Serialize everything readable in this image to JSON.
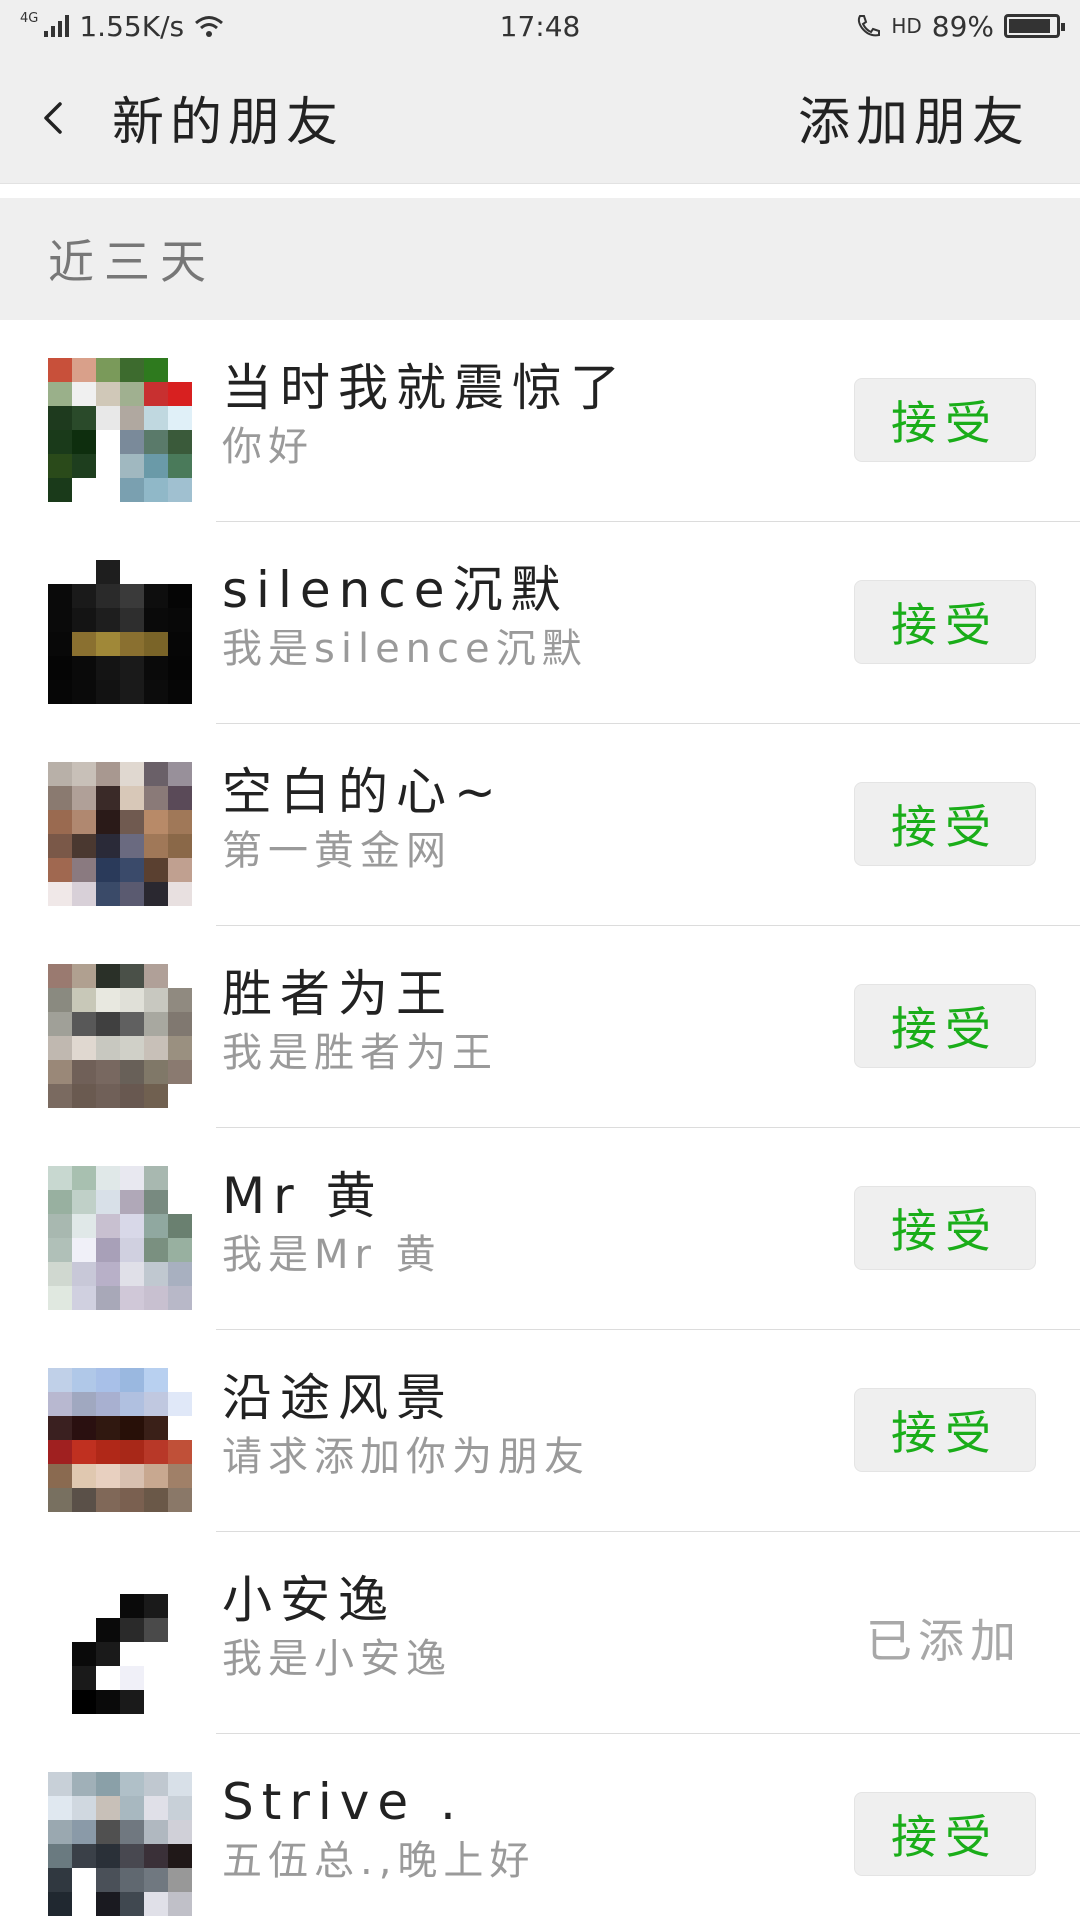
{
  "status_bar": {
    "network": "4G",
    "speed": "1.55K/s",
    "time": "17:48",
    "hd": "HD",
    "battery": "89%",
    "battery_level": 0.89
  },
  "nav": {
    "title": "新的朋友",
    "action": "添加朋友"
  },
  "section": {
    "title": "近三天"
  },
  "accent_color": "#1aad19",
  "friends": [
    {
      "name": "当时我就震惊了",
      "message": "你好",
      "action": "接受",
      "status": "pending",
      "avatar": [
        "#c8503a",
        "#d9a08a",
        "#7a9a5a",
        "#3d6b2e",
        "#2e7a1e",
        "#ffffff",
        "#9ab08a",
        "#f0f0f0",
        "#d0c8b8",
        "#a0b090",
        "#c83030",
        "#d82020",
        "#1e3a1e",
        "#2a4a2a",
        "#e8e8e8",
        "#b0a8a0",
        "#c0d8e0",
        "#e0f0f8",
        "#1a3a1a",
        "#0e2e0e",
        "#ffffff",
        "#7a8a9a",
        "#5a7a6a",
        "#3a5a3a",
        "#2a4a1a",
        "#1e3e1e",
        "#ffffff",
        "#a0b8c0",
        "#6a9aa8",
        "#4a7a5a",
        "#1a3a1a",
        "#ffffff",
        "#ffffff",
        "#7aa0b0",
        "#90b8c8",
        "#a0c0d0"
      ]
    },
    {
      "name": "silence沉默",
      "message": "我是silence沉默",
      "action": "接受",
      "status": "pending",
      "avatar": [
        "#ffffff",
        "#ffffff",
        "#1e1e1e",
        "#ffffff",
        "#ffffff",
        "#ffffff",
        "#0a0a0a",
        "#1a1a1a",
        "#2a2a2a",
        "#3a3a3a",
        "#0e0e0e",
        "#050505",
        "#0a0a0a",
        "#141414",
        "#1e1e1e",
        "#2e2e2e",
        "#0a0a0a",
        "#080808",
        "#080808",
        "#8a7030",
        "#a08838",
        "#8a7030",
        "#7a6428",
        "#060606",
        "#050505",
        "#0a0a0a",
        "#141414",
        "#1a1a1a",
        "#0a0a0a",
        "#050505",
        "#060606",
        "#0a0a0a",
        "#121212",
        "#1a1a1a",
        "#0c0c0c",
        "#060606"
      ]
    },
    {
      "name": "空白的心~",
      "message": "第一黄金网",
      "action": "接受",
      "status": "pending",
      "avatar": [
        "#b8b0a8",
        "#c8c0b8",
        "#a89890",
        "#e0d8d0",
        "#6a6068",
        "#98909a",
        "#8a7a70",
        "#b0a098",
        "#3a2a28",
        "#d8c8b8",
        "#8a7a78",
        "#5a4a58",
        "#9a6a50",
        "#b08870",
        "#2a1a18",
        "#705a50",
        "#b88a68",
        "#a07858",
        "#7a5848",
        "#4a3830",
        "#2a2a38",
        "#6a6a80",
        "#a07858",
        "#8a6848",
        "#a06850",
        "#8a7a80",
        "#2a3a5a",
        "#3a4a6a",
        "#5a4030",
        "#c0a090",
        "#f0e8e8",
        "#d8d0d8",
        "#3a4a68",
        "#5a5a70",
        "#2a2830",
        "#e8e0e0"
      ]
    },
    {
      "name": "胜者为王",
      "message": "我是胜者为王",
      "action": "接受",
      "status": "pending",
      "avatar": [
        "#9a7a70",
        "#b0a090",
        "#2a3028",
        "#4a5048",
        "#b0a098",
        "#ffffff",
        "#8a8a80",
        "#c8c8b8",
        "#e8e8e0",
        "#e0e0d8",
        "#c8c8c0",
        "#908a80",
        "#a0a098",
        "#585858",
        "#404040",
        "#606060",
        "#a8a8a0",
        "#807870",
        "#c0b8b0",
        "#e0d8d0",
        "#c8c8c0",
        "#d0d0c8",
        "#c8c0b8",
        "#9a9080",
        "#9a8878",
        "#706058",
        "#786860",
        "#686058",
        "#807868",
        "#8a7a70",
        "#7a6a60",
        "#6a5a50",
        "#706058",
        "#685850",
        "#706050",
        "#ffffff"
      ]
    },
    {
      "name": "Mr  黄",
      "message": "我是Mr  黄",
      "action": "接受",
      "status": "pending",
      "avatar": [
        "#c8d8d0",
        "#a8c0b0",
        "#e0e8e8",
        "#e8e8f0",
        "#a8b8b0",
        "#ffffff",
        "#98b0a0",
        "#c0d0c8",
        "#d8e0e8",
        "#b0a8b8",
        "#788a80",
        "#ffffff",
        "#a8b8b0",
        "#e0e8e8",
        "#c8c0d0",
        "#d8d8e8",
        "#90a8a0",
        "#6a8070",
        "#b0c0b8",
        "#f0f0f8",
        "#a8a0b8",
        "#d0d0e0",
        "#7a9080",
        "#98b0a0",
        "#d0d8d0",
        "#c8c8d8",
        "#b8b0c8",
        "#e0e0e8",
        "#c0c8d0",
        "#a8b0c0",
        "#e0e8e0",
        "#d0d0e0",
        "#a8a8b8",
        "#d0c8d8",
        "#c8c0d0",
        "#b8b8c8"
      ]
    },
    {
      "name": "沿途风景",
      "message": "请求添加你为朋友",
      "action": "接受",
      "status": "pending",
      "avatar": [
        "#c0d0e8",
        "#b0c8e8",
        "#a8c0e8",
        "#9ab8e0",
        "#b8d0f0",
        "#ffffff",
        "#b8b8d0",
        "#a0a8c0",
        "#a8b0d0",
        "#b0c0e0",
        "#c0c8e0",
        "#e0e8f8",
        "#3a2020",
        "#2a1010",
        "#301810",
        "#281008",
        "#3a2018",
        "#ffffff",
        "#a02020",
        "#c03020",
        "#b02818",
        "#a82818",
        "#b83828",
        "#c05038",
        "#8a6a50",
        "#e0c8b0",
        "#e8d0c0",
        "#d8c0b0",
        "#c8a890",
        "#a08068",
        "#787060",
        "#5a5048",
        "#806858",
        "#7a6050",
        "#6a5848",
        "#8a7868"
      ]
    },
    {
      "name": "小安逸",
      "message": "我是小安逸",
      "action": "已添加",
      "status": "added",
      "avatar": [
        "#ffffff",
        "#ffffff",
        "#ffffff",
        "#ffffff",
        "#ffffff",
        "#ffffff",
        "#ffffff",
        "#ffffff",
        "#ffffff",
        "#0a0a0a",
        "#1a1a1a",
        "#ffffff",
        "#ffffff",
        "#ffffff",
        "#0a0a0a",
        "#2a2a2a",
        "#4a4a4a",
        "#ffffff",
        "#ffffff",
        "#0a0a0a",
        "#1a1a1a",
        "#ffffff",
        "#ffffff",
        "#ffffff",
        "#ffffff",
        "#1a1a1a",
        "#ffffff",
        "#f0f0f8",
        "#ffffff",
        "#ffffff",
        "#ffffff",
        "#000000",
        "#0a0a0a",
        "#1a1a1a",
        "#ffffff",
        "#ffffff"
      ]
    },
    {
      "name": "Strive .",
      "message": "五伍总.,晚上好",
      "action": "接受",
      "status": "pending",
      "avatar": [
        "#c8d0d8",
        "#a0b0b8",
        "#8aa0a8",
        "#b0c0c8",
        "#c0c8d0",
        "#d8e0e8",
        "#e0e8f0",
        "#d0d8e0",
        "#c8c0b8",
        "#a8b8c0",
        "#e0e0e8",
        "#c8d0d8",
        "#9aa8b0",
        "#8a9aa8",
        "#505050",
        "#707880",
        "#b0b8c0",
        "#d0d0d8",
        "#6a7a80",
        "#3a4048",
        "#2a3038",
        "#484850",
        "#3a3038",
        "#201818",
        "#303840",
        "#ffffff",
        "#4a5058",
        "#606870",
        "#707880",
        "#989898",
        "#202830",
        "#ffffff",
        "#1a1a20",
        "#404850",
        "#e0e0e8",
        "#c0c0c8"
      ]
    }
  ]
}
